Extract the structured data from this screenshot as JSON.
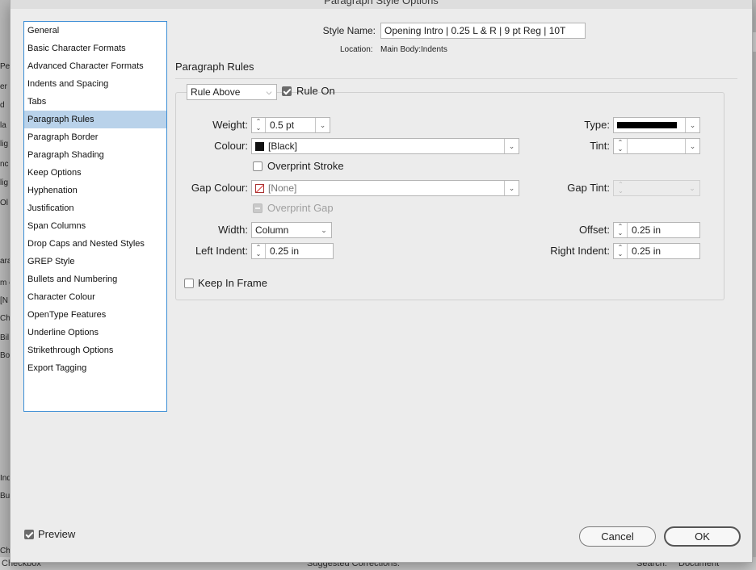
{
  "window": {
    "title": "Paragraph Style Options"
  },
  "sidebar": {
    "items": [
      "General",
      "Basic Character Formats",
      "Advanced Character Formats",
      "Indents and Spacing",
      "Tabs",
      "Paragraph Rules",
      "Paragraph Border",
      "Paragraph Shading",
      "Keep Options",
      "Hyphenation",
      "Justification",
      "Span Columns",
      "Drop Caps and Nested Styles",
      "GREP Style",
      "Bullets and Numbering",
      "Character Colour",
      "OpenType Features",
      "Underline Options",
      "Strikethrough Options",
      "Export Tagging"
    ],
    "selected": "Paragraph Rules"
  },
  "style_name": {
    "label": "Style Name:",
    "value": "Opening Intro | 0.25 L & R | 9 pt Reg | 10T"
  },
  "location": {
    "label": "Location:",
    "value": "Main Body:Indents"
  },
  "section_title": "Paragraph Rules",
  "rule": {
    "select": "Rule Above",
    "rule_on_label": "Rule On",
    "rule_on": true
  },
  "weight": {
    "label": "Weight:",
    "value": "0.5 pt"
  },
  "colour": {
    "label": "Colour:",
    "value": "[Black]"
  },
  "overprint_stroke": {
    "label": "Overprint Stroke",
    "checked": false
  },
  "gap_colour": {
    "label": "Gap Colour:",
    "value": "[None]"
  },
  "overprint_gap": {
    "label": "Overprint Gap",
    "checked": false,
    "disabled": true
  },
  "width": {
    "label": "Width:",
    "value": "Column"
  },
  "left_indent": {
    "label": "Left Indent:",
    "value": "0.25 in"
  },
  "type": {
    "label": "Type:"
  },
  "tint": {
    "label": "Tint:",
    "value": ""
  },
  "gap_tint": {
    "label": "Gap Tint:",
    "value": ""
  },
  "offset": {
    "label": "Offset:",
    "value": "0.25 in"
  },
  "right_indent": {
    "label": "Right Indent:",
    "value": "0.25 in"
  },
  "keep_in_frame": {
    "label": "Keep In Frame",
    "checked": false
  },
  "preview": {
    "label": "Preview",
    "checked": true
  },
  "buttons": {
    "cancel": "Cancel",
    "ok": "OK"
  },
  "background": {
    "left_fragments": [
      "Pe",
      "er",
      "d",
      "la",
      "lig",
      "nc",
      "lig",
      "Ol",
      "ara",
      "m c",
      "[N",
      "Ch",
      "Bil",
      "Bo",
      "Ind",
      "Bu",
      "Ch"
    ],
    "bottom_left": "Checkbox",
    "bottom_middle": "Suggested Corrections:",
    "bottom_right_label": "Search:",
    "bottom_right_value": "Document"
  },
  "colors": {
    "accent": "#3c8ed5",
    "selection": "#b9d2ea"
  }
}
